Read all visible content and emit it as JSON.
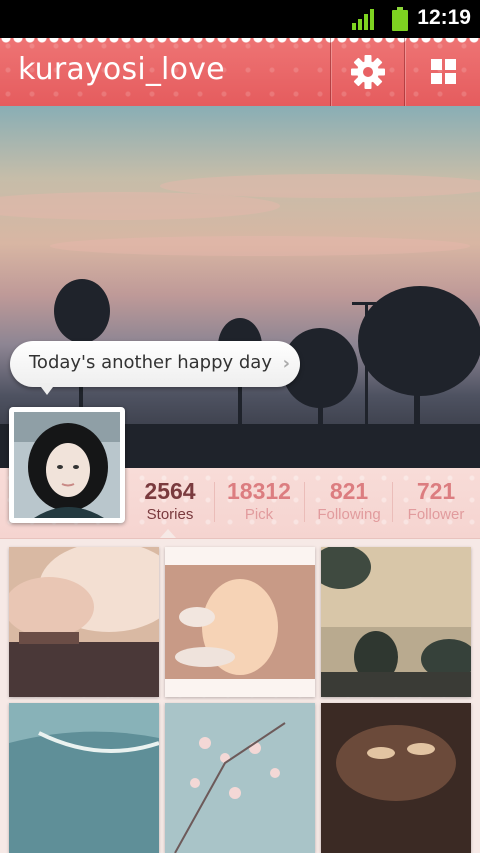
{
  "status_bar": {
    "time": "12:19"
  },
  "app_bar": {
    "title": "kurayosi_love",
    "settings_icon": "gear-icon",
    "menu_icon": "grid-icon"
  },
  "cover": {
    "status_message": "Today's another happy day"
  },
  "stats": [
    {
      "value": "2564",
      "label": "Stories",
      "active": true
    },
    {
      "value": "18312",
      "label": "Pick"
    },
    {
      "value": "821",
      "label": "Following"
    },
    {
      "value": "721",
      "label": "Follower"
    }
  ],
  "colors": {
    "app_bar": "#e55c5e",
    "active_stat": "#7a3a3e",
    "inactive_stat": "#dc7d80",
    "stats_background": "#f8dcd8"
  }
}
